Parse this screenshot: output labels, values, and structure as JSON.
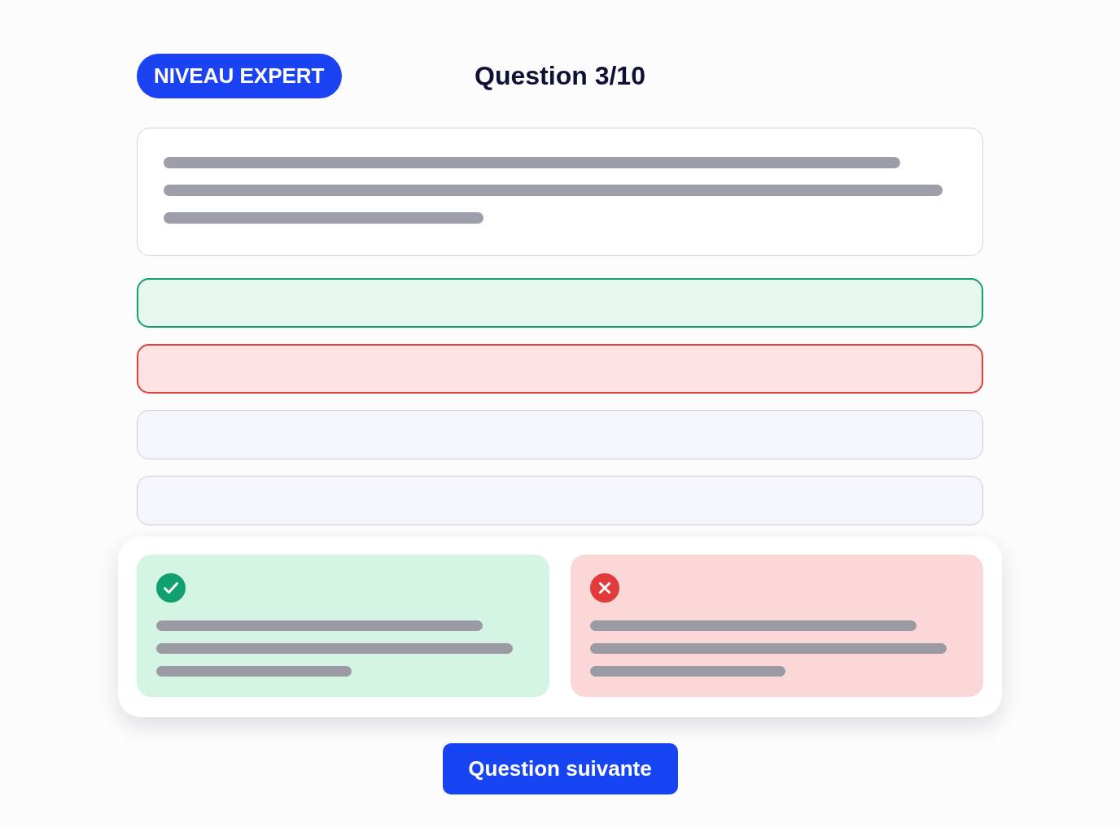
{
  "header": {
    "level_badge": "NIVEAU EXPERT",
    "progress": "Question 3/10"
  },
  "answers": [
    {
      "kind": "correct"
    },
    {
      "kind": "incorrect"
    },
    {
      "kind": "neutral"
    },
    {
      "kind": "neutral"
    }
  ],
  "feedback": [
    {
      "kind": "correct"
    },
    {
      "kind": "incorrect"
    }
  ],
  "next_button": "Question suivante"
}
